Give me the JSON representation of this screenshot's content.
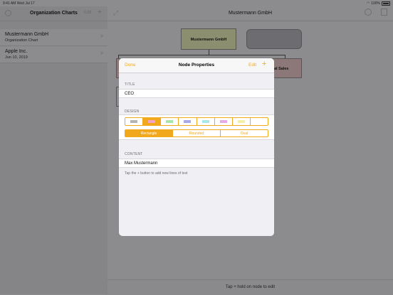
{
  "status": {
    "time": "9:41 AM  Wed Jul 17",
    "battery": "100%"
  },
  "sidebar": {
    "title": "Organization Charts",
    "edit_label": "Edit",
    "items": [
      {
        "name": "Mustermann GmbH",
        "subtitle": "Organization Chart"
      },
      {
        "name": "Apple Inc.",
        "subtitle": "Jun 10, 2019"
      }
    ]
  },
  "main": {
    "title": "Mustermann GmbH",
    "chart": {
      "root": "Mustermann GmbH",
      "child_partial": "al Sales"
    },
    "hint": "Tap + hold on node to edit"
  },
  "modal": {
    "done_label": "Done",
    "title": "Node Properties",
    "edit_label": "Edit",
    "title_section": "TITLE",
    "title_value": "CEO",
    "design_section": "DESIGN",
    "swatches": [
      "#b3b3b3",
      "#f4a3c6",
      "#a8e6a8",
      "#a9a9e8",
      "#a9e8e8",
      "#e8a9e8",
      "#f5f0a6",
      "#ffffff"
    ],
    "selected_swatch": 1,
    "shapes": [
      "Rectangle",
      "Rounded",
      "Oval"
    ],
    "selected_shape": 0,
    "content_section": "CONTENT",
    "content_value": "Max Mustermann",
    "content_footer": "Tap the + button to add new lines of text",
    "accent": "#f2a81c"
  }
}
